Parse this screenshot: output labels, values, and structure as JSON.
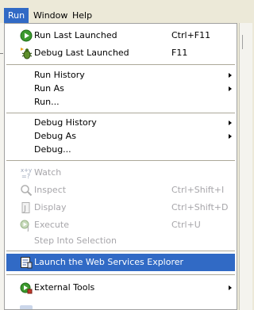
{
  "menubar": {
    "items": [
      {
        "label": "Run"
      },
      {
        "label": "Window"
      },
      {
        "label": "Help"
      }
    ]
  },
  "menu": {
    "items": [
      {
        "label": "Run Last Launched",
        "accel": "Ctrl+F11",
        "icon": "run-icon",
        "disabled": false
      },
      {
        "label": "Debug Last Launched",
        "accel": "F11",
        "icon": "debug-icon",
        "disabled": false
      },
      {
        "label": "Run History",
        "submenu": true
      },
      {
        "label": "Run As",
        "submenu": true
      },
      {
        "label": "Run..."
      },
      {
        "label": "Debug History",
        "submenu": true
      },
      {
        "label": "Debug As",
        "submenu": true
      },
      {
        "label": "Debug..."
      },
      {
        "label": "Watch",
        "icon": "watch-icon",
        "disabled": true
      },
      {
        "label": "Inspect",
        "accel": "Ctrl+Shift+I",
        "icon": "inspect-icon",
        "disabled": true
      },
      {
        "label": "Display",
        "accel": "Ctrl+Shift+D",
        "icon": "display-icon",
        "disabled": true
      },
      {
        "label": "Execute",
        "accel": "Ctrl+U",
        "icon": "execute-icon",
        "disabled": true
      },
      {
        "label": "Step Into Selection",
        "disabled": true
      },
      {
        "label": "Launch the Web Services Explorer",
        "icon": "web-services-explorer-icon",
        "highlighted": true
      },
      {
        "label": "External Tools",
        "icon": "external-tools-icon",
        "submenu": true
      }
    ]
  },
  "colors": {
    "highlight": "#316ac5",
    "disabled_text": "#a7a6aa",
    "menubar_bg": "#ece9d8",
    "menu_bg": "#ffffff"
  }
}
